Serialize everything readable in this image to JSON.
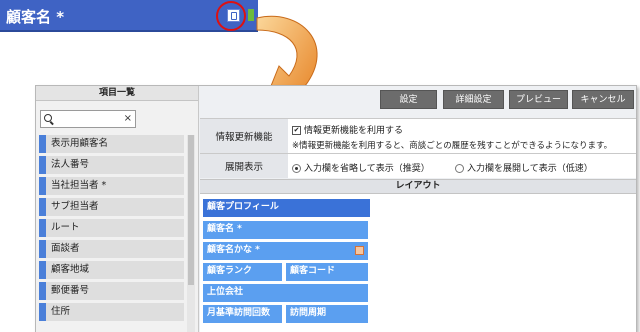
{
  "field_header": {
    "title": "顧客名 *"
  },
  "sidebar": {
    "title": "項目一覧",
    "search": {
      "value": "",
      "clear": "×"
    },
    "items": [
      {
        "label": "表示用顧客名"
      },
      {
        "label": "法人番号"
      },
      {
        "label": "当社担当者 *"
      },
      {
        "label": "サブ担当者"
      },
      {
        "label": "ルート"
      },
      {
        "label": "面談者"
      },
      {
        "label": "顧客地域"
      },
      {
        "label": "郵便番号"
      },
      {
        "label": "住所"
      }
    ]
  },
  "toolbar": {
    "settings": "設定",
    "detail_settings": "詳細設定",
    "preview": "プレビュー",
    "cancel": "キャンセル"
  },
  "info_update": {
    "label": "情報更新機能",
    "checkbox_label": "情報更新機能を利用する",
    "checked": true,
    "note": "※情報更新機能を利用すると、商談ごとの履歴を残すことができるようになります。"
  },
  "display": {
    "label": "展開表示",
    "option_collapsed": "入力欄を省略して表示（推奨）",
    "option_expanded": "入力欄を展開して表示（低速）",
    "selected": "option_collapsed"
  },
  "layout": {
    "title": "レイアウト",
    "section_title": "顧客プロフィール",
    "fields": {
      "name": "顧客名 *",
      "name_kana": "顧客名かな *",
      "rank": "顧客ランク",
      "code": "顧客コード",
      "parent": "上位会社",
      "monthly_visits": "月基準訪問回数",
      "visit_cycle": "訪問周期"
    }
  },
  "colors": {
    "header_blue": "#3f63c4",
    "field_block": "#5b9ff0",
    "section_block": "#3a72d8",
    "highlight_ring": "#dd1111",
    "arrow_orange": "#f09a3e"
  }
}
